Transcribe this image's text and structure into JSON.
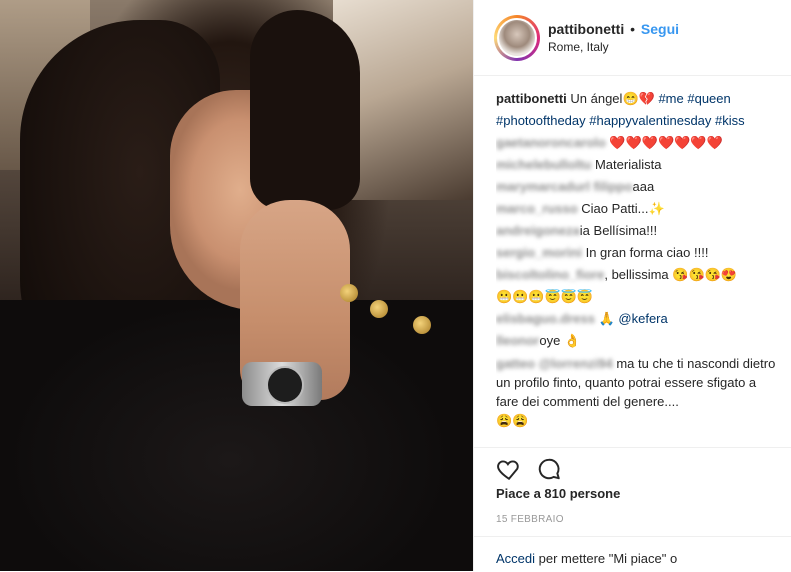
{
  "header": {
    "username": "pattibonetti",
    "separator": "•",
    "follow_label": "Segui",
    "location": "Rome, Italy"
  },
  "caption": {
    "user": "pattibonetti",
    "text": "Un ángel",
    "emoji": "😁💔",
    "tags": [
      "#me",
      "#queen",
      "#photooftheday",
      "#happyvalentinesday",
      "#kiss"
    ]
  },
  "comments": [
    {
      "user": "gaetanoroncarolo",
      "text": "",
      "emoji": "❤️❤️❤️❤️❤️❤️❤️"
    },
    {
      "user": "michelebulloltu",
      "text": "Materialista"
    },
    {
      "user": "marymarcadurl filippo",
      "text": "aaa"
    },
    {
      "user": "marco_russo",
      "text": "Ciao Patti...✨"
    },
    {
      "user": "andreigoneza",
      "text": "ia Bellísima!!!"
    },
    {
      "user": "sergio_morini",
      "text": "In gran forma ciao !!!!"
    },
    {
      "user": "biscoltolino_fiore",
      "text": ", bellissima",
      "emoji": "😘😘😘😍"
    },
    {
      "user": "",
      "text": "",
      "emoji": "😬😬😬😇😇😇"
    },
    {
      "user": "elisbaguo.dress",
      "text": "🙏 @kefera"
    },
    {
      "user": "lleonor",
      "text": "oye",
      "emoji": "👌"
    },
    {
      "user": "gatteo @lorrenzi94",
      "text": "ma tu che ti nascondi dietro un profilo finto, quanto potrai essere sfigato a fare dei commenti del genere....",
      "emoji": "😩😩"
    }
  ],
  "actions": {
    "like_icon": "heart-outline-icon",
    "comment_icon": "comment-bubble-icon",
    "likes_text": "Piace a 810 persone",
    "date": "15 FEBBRAIO"
  },
  "login": {
    "link": "Accedi",
    "rest": "per mettere \"Mi piace\" o"
  }
}
